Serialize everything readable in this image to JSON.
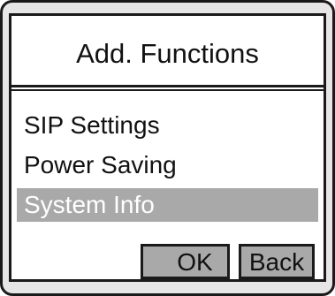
{
  "dialog": {
    "title": "Add. Functions"
  },
  "menu": {
    "items": [
      {
        "label": "SIP Settings",
        "selected": false
      },
      {
        "label": "Power Saving",
        "selected": false
      },
      {
        "label": "System Info",
        "selected": true
      }
    ]
  },
  "softkeys": {
    "ok_label": "OK",
    "back_label": "Back"
  },
  "colors": {
    "frame": "#e6e6e6",
    "screen": "#ffffff",
    "selection": "#a9a9a9",
    "border": "#1a1a1a",
    "text": "#111111",
    "selected_text": "#ffffff"
  }
}
